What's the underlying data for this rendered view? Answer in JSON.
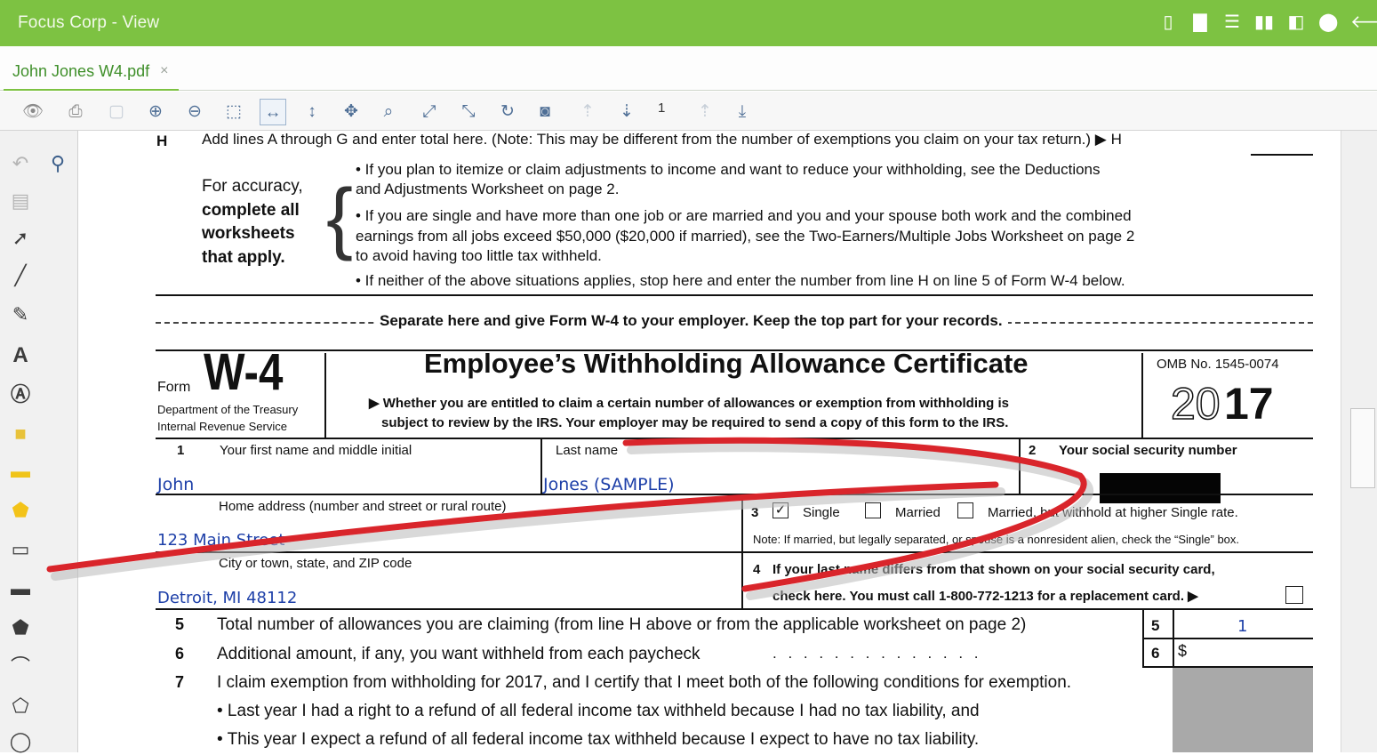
{
  "window": {
    "title": "Focus Corp - View",
    "icons": [
      "document-icon",
      "single-page-icon",
      "stack-icon",
      "columns-icon",
      "panel-icon",
      "location-pin-icon",
      "back-arrow-icon"
    ]
  },
  "tab": {
    "label": "John Jones W4.pdf",
    "close": "×"
  },
  "toolbar": {
    "page_number": "1"
  },
  "form": {
    "line_h_label": "H",
    "line_h_text": "Add lines A through G and enter total here. (Note: This may be different from the number of exemptions you claim on your tax return.) ▶ H",
    "accuracy_1": "For accuracy,",
    "accuracy_2": "complete all",
    "accuracy_3": "worksheets",
    "accuracy_4": "that apply.",
    "bullet1_a": "• If you plan to itemize or claim adjustments to income and want to reduce your withholding, see the Deductions",
    "bullet1_b": "and Adjustments Worksheet on page 2.",
    "bullet2_a": "• If you are single and have more than one job or are married and you and your spouse both work and the combined",
    "bullet2_b": "earnings from all jobs exceed $50,000 ($20,000 if married), see the Two-Earners/Multiple Jobs Worksheet on page 2",
    "bullet2_c": "to avoid having too little tax withheld.",
    "bullet3": "• If neither of the above situations applies, stop here and enter the number from line H on line 5 of Form W-4 below.",
    "separate": "Separate here and give Form W-4 to your employer. Keep the top part for your records.",
    "form_word": "Form",
    "form_name": "W-4",
    "dept_1": "Department of the Treasury",
    "dept_2": "Internal Revenue Service",
    "cert_title": "Employee’s Withholding Allowance Certificate",
    "cert_sub_1": "▶ Whether you are entitled to claim a certain number of allowances or exemption from withholding is",
    "cert_sub_2": "subject to review by the IRS. Your employer may be required to send a copy of this form to the IRS.",
    "omb": "OMB No. 1545-0074",
    "year_light": "20",
    "year_bold": "17",
    "l1_num": "1",
    "l1_label": "Your first name and middle initial",
    "l1_value": "John",
    "last_label": "Last name",
    "last_value": "Jones (SAMPLE)",
    "l2_num": "2",
    "l2_label": "Your social security number",
    "addr_label": "Home address (number and street or rural route)",
    "addr_value": "123 Main Street",
    "l3_num": "3",
    "single_check": "✓",
    "single": "Single",
    "married": "Married",
    "married_higher": "Married, but withhold at higher Single rate.",
    "note": "Note: If married, but legally separated, or spouse is a nonresident alien, check the “Single” box.",
    "city_label": "City or town, state, and ZIP code",
    "city_value": "Detroit, MI 48112",
    "l4_num": "4",
    "l4_a": "If your last name differs from that shown on your social security card,",
    "l4_b": "check here. You must call 1-800-772-1213 for a replacement card. ▶",
    "l5_num": "5",
    "l5_text": "Total number of allowances you are claiming (from line H above or from the applicable worksheet on page 2)",
    "l5_box": "5",
    "l5_value": "1",
    "l6_num": "6",
    "l6_text": "Additional amount, if any, you want withheld from each paycheck",
    "l6_dots": ". . . . . . . . . . . . . .",
    "l6_box": "6",
    "l6_dollar": "$",
    "l7_num": "7",
    "l7_text": "I claim exemption from withholding for 2017, and I certify that I meet both of the following conditions for exemption.",
    "l7_b1": "• Last year I had a right to a refund of all federal income tax withheld because I had no tax liability, and",
    "l7_b2": "• This year I expect a refund of all federal income tax withheld because I expect to have no tax liability."
  },
  "colors": {
    "titlebar": "#7dc242",
    "tab_text": "#3f8f2a",
    "toolbar_icon": "#4f6f96",
    "annotation": "#d9252b",
    "filled_text": "#1d3fa8"
  }
}
